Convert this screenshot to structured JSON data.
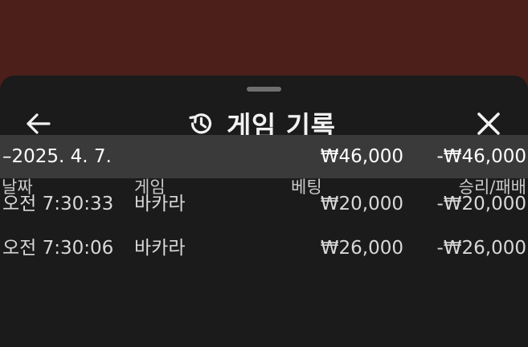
{
  "header": {
    "title": "게임 기록",
    "back_icon": "arrow-left-icon",
    "history_icon": "history-icon",
    "close_icon": "close-icon"
  },
  "columns": {
    "date": "날짜",
    "game": "게임",
    "bet": "베팅",
    "result": "승리/패배"
  },
  "date_group": {
    "date": "–2025. 4. 7.",
    "bet_total": "₩46,000",
    "result_total": "-₩46,000"
  },
  "rows": [
    {
      "time": "오전 7:30:33",
      "game": "바카라",
      "bet": "₩20,000",
      "result": "-₩20,000"
    },
    {
      "time": "오전 7:30:06",
      "game": "바카라",
      "bet": "₩26,000",
      "result": "-₩26,000"
    }
  ],
  "colors": {
    "backdrop": "#4c1f1a",
    "sheet": "#1b1b1b",
    "group_row": "#3a3a3a",
    "text": "#d8d8d8"
  }
}
